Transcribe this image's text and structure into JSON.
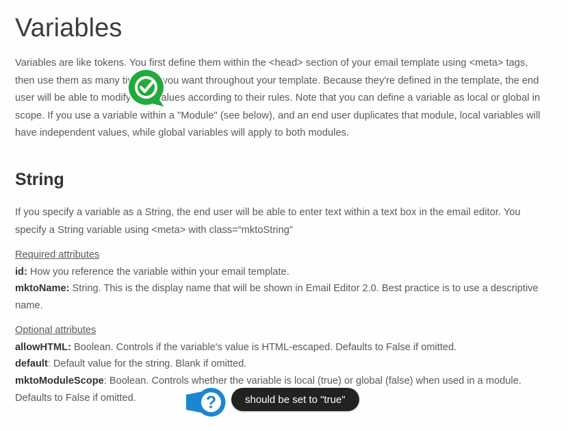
{
  "page": {
    "title": "Variables",
    "intro": "Variables are like tokens. You first define them within the <head> section of your email template using <meta> tags, then use them as many times as you want throughout your template. Because they're defined in the template, the end user will be able to modify their values according to their rules. Note that you can define a variable as local or global in scope. If you use a variable within a \"Module\" (see below), and an end user duplicates that module, local variables will have independent values, while global variables will apply to both modules."
  },
  "string_section": {
    "heading": "String",
    "paragraph": "If you specify a variable as a String, the end user will be able to enter text within a text box in the email editor. You specify a String variable using <meta> with class=“mktoString”",
    "required": {
      "heading": "Required attributes",
      "items": [
        {
          "name": "id:",
          "desc": " How you reference the variable within your email template."
        },
        {
          "name": "mktoName:",
          "desc": " String. This is the display name that will be shown in Email Editor 2.0. Best practice is to use a descriptive name."
        }
      ]
    },
    "optional": {
      "heading": "Optional attributes",
      "items": [
        {
          "name": "allowHTML:",
          "desc": " Boolean. Controls if the variable's value is HTML-escaped. Defaults to False if omitted."
        },
        {
          "name": "default",
          "desc": ": Default value for the string. Blank if omitted."
        },
        {
          "name": "mktoModuleScope",
          "desc": ": Boolean. Controls whether the variable is local (true) or global (false) when used in a module. Defaults to False if omitted."
        }
      ]
    }
  },
  "annotations": {
    "green_marker": {
      "icon": "check-circle-marker-icon",
      "color": "#22ab3b"
    },
    "blue_marker": {
      "icon": "question-mark-marker-icon",
      "color": "#1b87d2"
    },
    "tooltip": {
      "text": "should be set to \"true\"",
      "background": "#222222",
      "text_color": "#ffffff"
    }
  }
}
